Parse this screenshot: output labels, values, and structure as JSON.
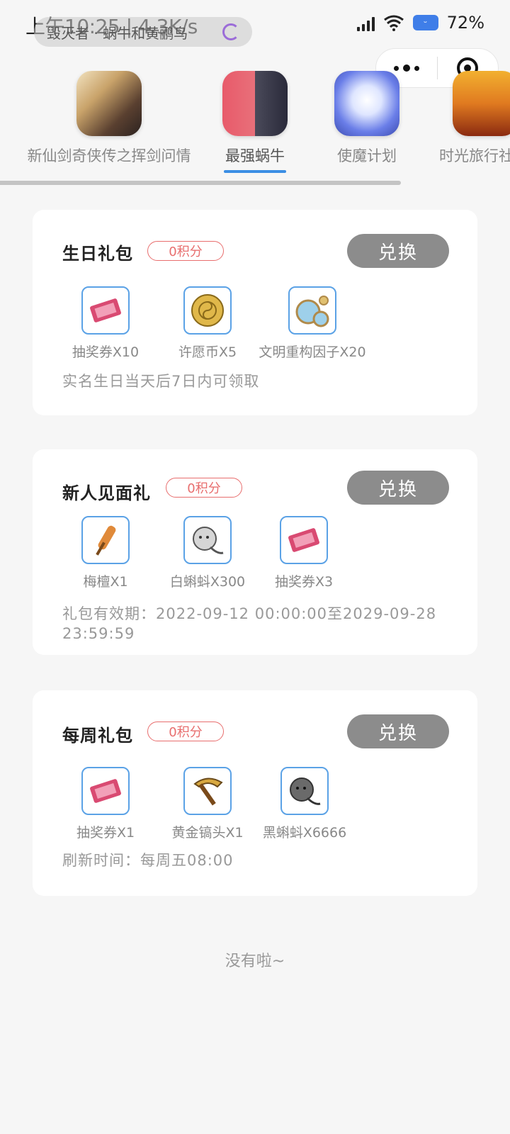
{
  "status_bar": {
    "time": "上午10:25 | 4.3K/s",
    "battery": "72%"
  },
  "mini_program": {
    "title": "毁灭者 · 蜗牛和黄鹂鸟"
  },
  "game_tabs": [
    {
      "label": "新仙剑奇侠传之挥剑问情",
      "icon": "xianjian-icon",
      "active": false
    },
    {
      "label": "最强蜗牛",
      "icon": "snail-icon",
      "active": true
    },
    {
      "label": "使魔计划",
      "icon": "shimo-icon",
      "active": false
    },
    {
      "label": "时光旅行社",
      "icon": "time-voyager-icon",
      "active": false
    }
  ],
  "gift_packs": [
    {
      "title": "生日礼包",
      "points": "0积分",
      "button": "兑换",
      "rewards": [
        {
          "label": "抽奖券X10",
          "icon": "lottery-ticket-icon"
        },
        {
          "label": "许愿币X5",
          "icon": "wish-coin-icon"
        },
        {
          "label": "文明重构因子X20",
          "icon": "civilization-factor-icon"
        }
      ],
      "note": "实名生日当天后7日内可领取"
    },
    {
      "title": "新人见面礼",
      "points": "0积分",
      "button": "兑换",
      "rewards": [
        {
          "label": "梅檀X1",
          "icon": "sandalwood-icon"
        },
        {
          "label": "白蝌蚪X300",
          "icon": "white-tadpole-icon"
        },
        {
          "label": "抽奖券X3",
          "icon": "lottery-ticket-icon"
        }
      ],
      "note": "礼包有效期：2022-09-12 00:00:00至2029-09-28 23:59:59"
    },
    {
      "title": "每周礼包",
      "points": "0积分",
      "button": "兑换",
      "rewards": [
        {
          "label": "抽奖券X1",
          "icon": "lottery-ticket-icon"
        },
        {
          "label": "黄金镐头X1",
          "icon": "golden-pickaxe-icon"
        },
        {
          "label": "黑蝌蚪X6666",
          "icon": "black-tadpole-icon"
        }
      ],
      "note": "刷新时间：每周五08:00"
    }
  ],
  "footer": "没有啦~",
  "colors": {
    "accent_blue": "#3b8ee4",
    "badge_red": "#e86e6e",
    "button_gray": "#8c8c8c"
  }
}
